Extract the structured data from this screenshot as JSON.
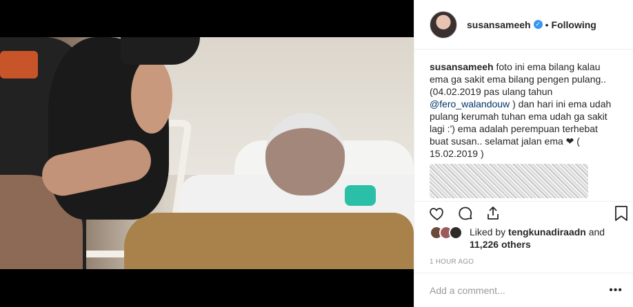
{
  "post": {
    "username": "susansameeh",
    "separator": "•",
    "follow_status": "Following",
    "verified_glyph": "✓"
  },
  "caption": {
    "username": "susansameeh",
    "text_before": "foto ini ema bilang kalau ema ga sakit ema bilang pengen pulang.. (04.02.2019 pas ulang tahun",
    "mention": "@fero_walandouw",
    "text_after": ") dan hari ini ema udah pulang kerumah tuhan ema udah ga sakit lagi :') ema adalah perempuan terhebat buat susan.. selamat jalan ema ❤ ( 15.02.2019 )"
  },
  "likes": {
    "prefix": "Liked by",
    "liker": "tengkunadiraadn",
    "conj": "and",
    "others": "11,226 others"
  },
  "timestamp": "1 HOUR AGO",
  "comment": {
    "placeholder": "Add a comment...",
    "more": "•••"
  },
  "icons": {
    "like": "heart-icon",
    "comment": "comment-icon",
    "share": "share-icon",
    "save": "bookmark-icon"
  },
  "colors": {
    "verified": "#3897f0",
    "mention": "#003569",
    "muted": "#999999",
    "border": "#efefef"
  }
}
